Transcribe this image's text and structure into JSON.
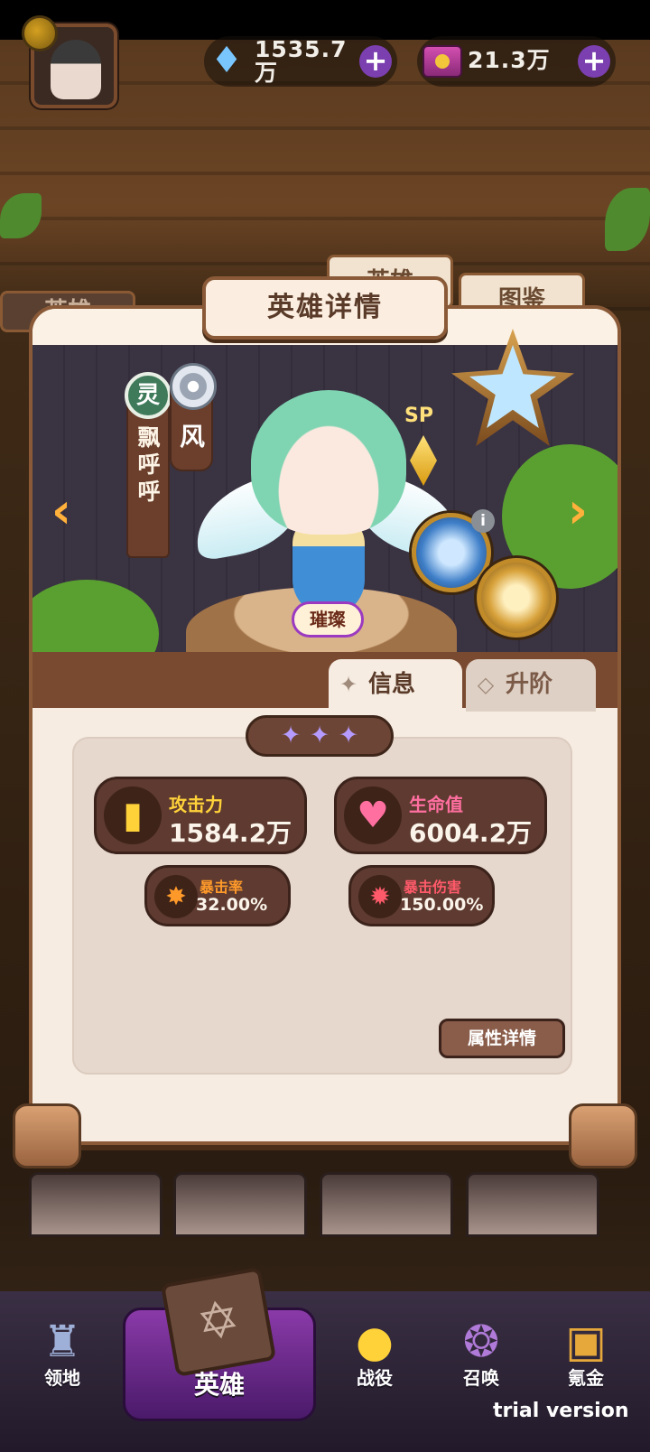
{
  "top_bar": {
    "gems_value": "1535.7\n万",
    "tickets_value": "21.3万",
    "gem_icon": "diamond-icon",
    "ticket_icon": "ticket-icon",
    "plus_label": "+"
  },
  "background_tabs": [
    "英雄",
    "英雄",
    "图鉴"
  ],
  "panel": {
    "title": "英雄详情",
    "hero_name": "飘呼呼",
    "race": "灵",
    "element": "风",
    "rarity": "璀璨",
    "grade": "SP",
    "nav_prev": "‹",
    "nav_next": "›",
    "info_marker": "i"
  },
  "tabs": {
    "info": "信息",
    "upgrade": "升阶"
  },
  "stars": [
    "✦",
    "✦",
    "✦"
  ],
  "stats": {
    "attack": {
      "label": "攻击力",
      "value": "1584.2万",
      "icon": "attack-icon",
      "color": "#ffd23a"
    },
    "hp": {
      "label": "生命值",
      "value": "6004.2万",
      "icon": "heart-icon",
      "color": "#ff6fa0"
    },
    "crit_rate": {
      "label": "暴击率",
      "value": "32.00%",
      "icon": "crit-icon",
      "color": "#ff9a2a"
    },
    "crit_damage": {
      "label": "暴击伤害",
      "value": "150.00%",
      "icon": "crit-damage-icon",
      "color": "#ff5a6a"
    }
  },
  "detail_button": "属性详情",
  "bottom_nav": {
    "territory": "领地",
    "hero": "英雄",
    "battle": "战役",
    "summon": "召唤",
    "krypton": "氪金"
  },
  "watermark": "trial version",
  "colors": {
    "accent_purple": "#8a3aa8",
    "panel_bg": "#f6ece2",
    "wood_brown": "#8a5a38"
  }
}
